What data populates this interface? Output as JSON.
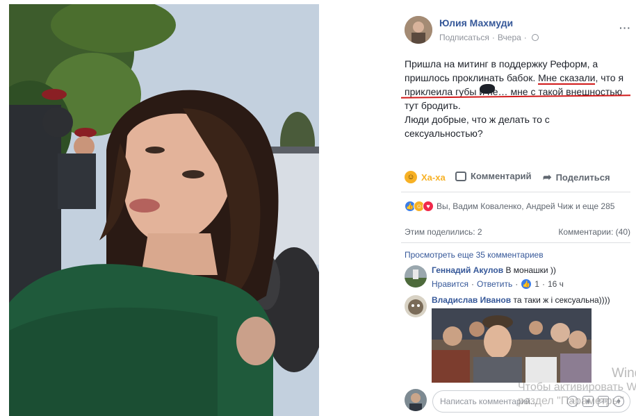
{
  "post": {
    "author": "Юлия Махмуди",
    "follow": "Подписаться",
    "time": "Вчера",
    "more": "···",
    "text": {
      "line1": "Пришла на митинг в поддержку Реформ, а",
      "line2a": "пришлось проклинать бабок. ",
      "line2b": "Мне сказали",
      "line2c": ", что я",
      "line3": "приклеила губы и не… мне с такой внешностью",
      "line4": "тут бродить.",
      "line5": "Люди добрые, что ж делать то с сексуальностью?"
    }
  },
  "actions": {
    "haha": "Ха-ха",
    "comment": "Комментарий",
    "share": "Поделиться"
  },
  "reactions": {
    "summary": "Вы, Вадим Коваленко, Андрей Чиж и еще 285",
    "shares": "Этим поделились: 2",
    "comments": "Комментарии: (40)"
  },
  "comments": {
    "view_more": "Просмотреть еще 35 комментариев",
    "items": [
      {
        "name": "Геннадий Акулов",
        "text": "В монашки ))",
        "like": "Нравится",
        "reply": "Ответить",
        "likes": "1",
        "time": "16 ч"
      },
      {
        "name": "Владислав Иванов",
        "text": "та таки ж і сексуальна))))"
      }
    ],
    "input_placeholder": "Написать комментарий..."
  },
  "watermark": {
    "line1": "Window",
    "line2": "Чтобы активировать Wi",
    "line3": "раздел \"Параметры\""
  },
  "colors": {
    "link": "#365899",
    "muted": "#90949c",
    "underline_red": "#d11a1a",
    "haha": "#f7b125"
  }
}
